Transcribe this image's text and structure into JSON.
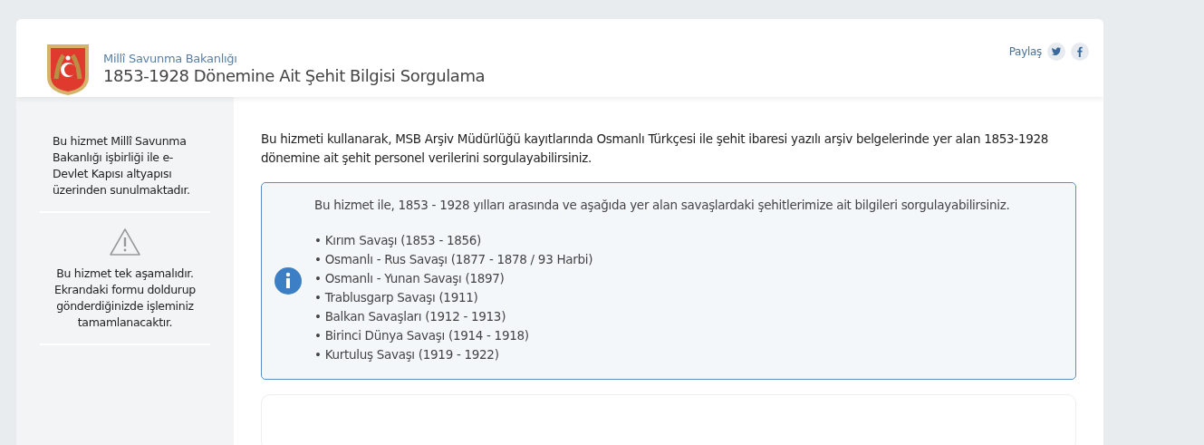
{
  "header": {
    "ministry": "Millî Savunma Bakanlığı",
    "title": "1853-1928 Dönemine Ait Şehit Bilgisi Sorgulama",
    "share_label": "Paylaş"
  },
  "sidebar": {
    "notes": [
      {
        "kind": "plain",
        "text": "Bu hizmet Millî Savunma Bakanlığı işbirliği ile e-Devlet Kapısı altyapısı üzerinden sunulmaktadır."
      },
      {
        "kind": "warning",
        "text": "Bu hizmet tek aşamalıdır. Ekrandaki formu doldurup gönderdiğinizde işleminiz tamamlanacaktır."
      }
    ]
  },
  "main": {
    "intro": "Bu hizmeti kullanarak, MSB Arşiv Müdürlüğü kayıtlarında Osmanlı Türkçesi ile şehit ibaresi yazılı arşiv belgelerinde yer alan 1853-1928 dönemine ait şehit personel verilerini sorgulayabilirsiniz.",
    "info_box": {
      "lead": "Bu hizmet ile, 1853 - 1928 yılları arasında ve aşağıda yer alan savaşlardaki şehitlerimize ait bilgileri sorgulayabilirsiniz.",
      "items": [
        "• Kırım Savaşı (1853 - 1856)",
        "• Osmanlı - Rus Savaşı (1877 - 1878 / 93 Harbi)",
        "• Osmanlı - Yunan Savaşı (1897)",
        "• Trablusgarp Savaşı (1911)",
        "• Balkan Savaşları (1912 - 1913)",
        "• Birinci Dünya Savaşı (1914 - 1918)",
        "• Kurtuluş Savaşı (1919 - 1922)"
      ]
    }
  }
}
